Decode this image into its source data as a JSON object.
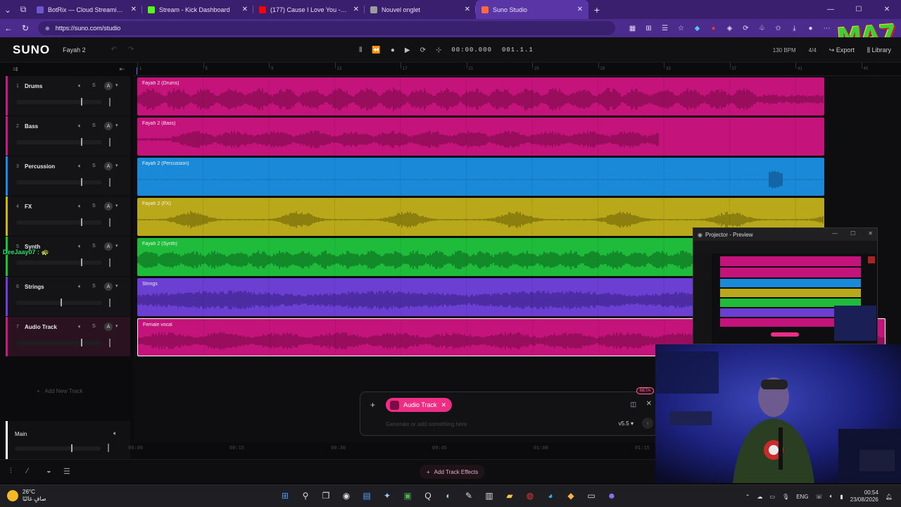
{
  "browser": {
    "tabs": [
      {
        "title": "BotRix — Cloud Streaming Bot for",
        "color": "#6e56cf"
      },
      {
        "title": "Stream - Kick Dashboard",
        "color": "#53fc18"
      },
      {
        "title": "(177) Cause I Love You - Lenn",
        "color": "#ff0000"
      },
      {
        "title": "Nouvel onglet",
        "color": "#9c9c9c"
      },
      {
        "title": "Suno Studio",
        "color": "#ff6a3d"
      }
    ],
    "url": "https://suno.com/studio",
    "overlay_logo": "MA7"
  },
  "app": {
    "brand": "SUNO",
    "project": "Fayah 2",
    "time": "00:00.000",
    "bar": "001.1.1",
    "bpm": "130 BPM",
    "signature": "4/4",
    "export_label": "Export",
    "library_label": "Library"
  },
  "ruler": [
    "1",
    "5",
    "9",
    "13",
    "17",
    "21",
    "25",
    "29",
    "33",
    "37",
    "41",
    "45"
  ],
  "tracks": [
    {
      "num": "1",
      "name": "Drums",
      "color": "#c01f80",
      "clip": "Fayah 2 (Drums)",
      "clip_color": "#c4137a",
      "wave_color": "#7a0a4a",
      "fader": 0.75
    },
    {
      "num": "2",
      "name": "Bass",
      "color": "#c01f80",
      "clip": "Fayah 2 (Bass)",
      "clip_color": "#c4137a",
      "wave_color": "#7a0a4a",
      "fader": 0.75
    },
    {
      "num": "3",
      "name": "Percussion",
      "color": "#1e88e5",
      "clip": "Fayah 2 (Percussion)",
      "clip_color": "#1a8ad8",
      "wave_color": "#0d4f86",
      "fader": 0.75
    },
    {
      "num": "4",
      "name": "FX",
      "color": "#c9b514",
      "clip": "Fayah 2 (FX)",
      "clip_color": "#b8a81a",
      "wave_color": "#6f6408",
      "fader": 0.75
    },
    {
      "num": "5",
      "name": "Synth",
      "color": "#1fbf3a",
      "clip": "Fayah 2 (Synth)",
      "clip_color": "#1fbb3b",
      "wave_color": "#0c6a1f",
      "fader": 0.75
    },
    {
      "num": "6",
      "name": "Strings",
      "color": "#6d3fd6",
      "clip": "Strings",
      "clip_color": "#6a3fd2",
      "wave_color": "#3a1f86",
      "fader": 0.52
    },
    {
      "num": "7",
      "name": "Audio Track",
      "color": "#c01f80",
      "clip": "Female vocal",
      "clip_color": "#c4137a",
      "wave_color": "#7a0a4a",
      "fader": 0.75
    }
  ],
  "add_track_label": "Add New Track",
  "main_label": "Main",
  "time_axis": [
    "00:00",
    "00:15",
    "00:30",
    "00:45",
    "01:00",
    "01:15"
  ],
  "effects_label": "Add Track Effects",
  "prompt": {
    "chip_label": "Audio Track",
    "placeholder": "Generate or add something here",
    "version": "v5.5",
    "beta": "BETA"
  },
  "projector_title": "Projector - Preview",
  "chat": {
    "user": "DeeJaay07 :",
    "emoji": "🐢"
  },
  "taskbar": {
    "temp": "26°C",
    "condition": "صافٍ غالبًا",
    "lang": "ENG",
    "time": "00:54",
    "date": "23/08/2026"
  }
}
